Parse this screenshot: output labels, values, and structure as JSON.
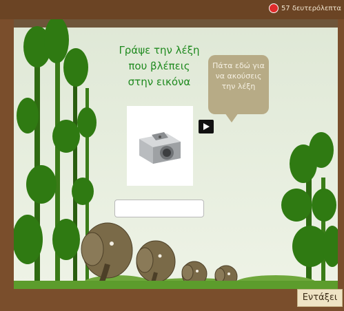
{
  "header": {
    "badge_icon": "notification-badge",
    "top_text": "57 δευτερόλεπτα"
  },
  "instruction": {
    "line1": "Γράψε την λέξη",
    "line2": "που βλέπεις",
    "line3": "στην εικόνα"
  },
  "speech_bubble": {
    "line1": "Πάτα εδώ για",
    "line2": "να ακούσεις",
    "line3": "την λέξη"
  },
  "picture": {
    "icon": "pencil-sharpener-image"
  },
  "answer_input": {
    "value": "",
    "placeholder": ""
  },
  "ok_button": {
    "label": "Εντάξει"
  },
  "colors": {
    "title_green": "#1f8a1f",
    "bubble": "#b7ab86",
    "frame_brown": "#7a4e2c"
  }
}
